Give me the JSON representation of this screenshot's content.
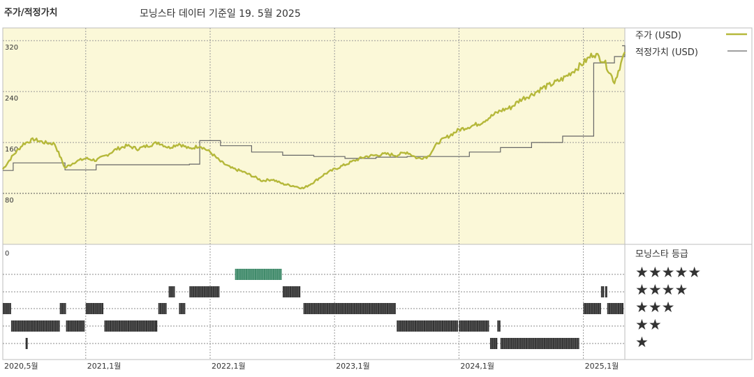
{
  "header": {
    "left_title": "주가/적정가치",
    "subtitle": "모닝스타 데이터 기준일 19. 5월 2025"
  },
  "colors": {
    "price_line": "#b5b83a",
    "fair_value_line": "#666666",
    "plot_bg": "#fbf8d8",
    "gold_rating": "#3f8a6a",
    "rating_bar": "#333333"
  },
  "chart_data": [
    {
      "type": "line",
      "x_unit": "month",
      "xlim": [
        "2020-05",
        "2025-05"
      ],
      "ylim": [
        0,
        340
      ],
      "y_ticks": [
        "0",
        "80",
        "160",
        "240",
        "320"
      ],
      "grid": true,
      "legend_position": "right",
      "series": [
        {
          "name": "주가 (USD)",
          "x": [
            "2020-05",
            "2020-06",
            "2020-07",
            "2020-08",
            "2020-09",
            "2020-10",
            "2020-11",
            "2020-12",
            "2021-01",
            "2021-02",
            "2021-03",
            "2021-04",
            "2021-05",
            "2021-06",
            "2021-07",
            "2021-08",
            "2021-09",
            "2021-10",
            "2021-11",
            "2021-12",
            "2022-01",
            "2022-02",
            "2022-03",
            "2022-04",
            "2022-05",
            "2022-06",
            "2022-07",
            "2022-08",
            "2022-09",
            "2022-10",
            "2022-11",
            "2022-12",
            "2023-01",
            "2023-02",
            "2023-03",
            "2023-04",
            "2023-05",
            "2023-06",
            "2023-07",
            "2023-08",
            "2023-09",
            "2023-10",
            "2023-11",
            "2023-12",
            "2024-01",
            "2024-02",
            "2024-03",
            "2024-04",
            "2024-05",
            "2024-06",
            "2024-07",
            "2024-08",
            "2024-09",
            "2024-10",
            "2024-11",
            "2024-12",
            "2025-01",
            "2025-02",
            "2025-03",
            "2025-04",
            "2025-05"
          ],
          "values": [
            118,
            140,
            158,
            165,
            160,
            158,
            120,
            130,
            135,
            132,
            140,
            150,
            155,
            150,
            155,
            160,
            152,
            158,
            150,
            155,
            145,
            130,
            120,
            115,
            108,
            100,
            102,
            95,
            92,
            88,
            98,
            110,
            118,
            125,
            132,
            138,
            140,
            142,
            140,
            145,
            135,
            138,
            160,
            170,
            180,
            185,
            190,
            200,
            210,
            215,
            228,
            235,
            245,
            252,
            260,
            272,
            285,
            300,
            288,
            255,
            302
          ]
        },
        {
          "name": "적정가치 (USD)",
          "x": [
            "2020-05",
            "2020-06",
            "2020-08",
            "2020-10",
            "2020-11",
            "2021-02",
            "2021-05",
            "2021-08",
            "2021-11",
            "2021-12",
            "2022-02",
            "2022-05",
            "2022-08",
            "2022-11",
            "2023-02",
            "2023-05",
            "2023-08",
            "2023-11",
            "2024-02",
            "2024-05",
            "2024-08",
            "2024-11",
            "2025-01",
            "2025-02",
            "2025-03",
            "2025-04",
            "2025-05"
          ],
          "values": [
            116,
            128,
            128,
            128,
            117,
            125,
            125,
            125,
            126,
            163,
            155,
            145,
            140,
            138,
            135,
            137,
            138,
            138,
            145,
            152,
            160,
            170,
            170,
            285,
            285,
            295,
            312
          ]
        }
      ]
    },
    {
      "type": "scatter",
      "title": "모닝스타 등급",
      "x_unit": "month",
      "xlim": [
        "2020-05",
        "2025-05"
      ],
      "x_tick_labels": [
        "2020,5월",
        "2021,1월",
        "2022,1월",
        "2023,1월",
        "2024,1월",
        "2025,1월"
      ],
      "levels": [
        5,
        4,
        3,
        2,
        1
      ],
      "level_labels": [
        "★★★★★",
        "★★★★",
        "★★★",
        "★★",
        "★"
      ],
      "segments": [
        {
          "stars": 3,
          "from": "2020-05",
          "to": "2020-05.8"
        },
        {
          "stars": 2,
          "from": "2020-05.8",
          "to": "2020-07.8"
        },
        {
          "stars": 1,
          "from": "2020-07.2",
          "to": "2020-07.4"
        },
        {
          "stars": 2,
          "from": "2020-07.8",
          "to": "2020-10.5"
        },
        {
          "stars": 3,
          "from": "2020-10.5",
          "to": "2020-11.1"
        },
        {
          "stars": 2,
          "from": "2020-11.1",
          "to": "2020-12.9"
        },
        {
          "stars": 3,
          "from": "2021-01",
          "to": "2021-02.7"
        },
        {
          "stars": 2,
          "from": "2021-02.8",
          "to": "2021-07.9"
        },
        {
          "stars": 3,
          "from": "2021-08",
          "to": "2021-08.8"
        },
        {
          "stars": 4,
          "from": "2021-09",
          "to": "2021-09.6"
        },
        {
          "stars": 3,
          "from": "2021-10",
          "to": "2021-10.6"
        },
        {
          "stars": 4,
          "from": "2021-11",
          "to": "2022-01.9"
        },
        {
          "stars": 5,
          "from": "2022-03.4",
          "to": "2022-07.9"
        },
        {
          "stars": 4,
          "from": "2022-08",
          "to": "2022-09.7"
        },
        {
          "stars": 3,
          "from": "2022-10",
          "to": "2023-06.9"
        },
        {
          "stars": 2,
          "from": "2023-07",
          "to": "2023-12.9"
        },
        {
          "stars": 2,
          "from": "2024-01",
          "to": "2024-03.9"
        },
        {
          "stars": 1,
          "from": "2024-04",
          "to": "2024-04.7"
        },
        {
          "stars": 2,
          "from": "2024-04.7",
          "to": "2024-05"
        },
        {
          "stars": 1,
          "from": "2024-05",
          "to": "2024-12.6"
        },
        {
          "stars": 3,
          "from": "2025-01",
          "to": "2025-02.7"
        },
        {
          "stars": 4,
          "from": "2025-02.7",
          "to": "2025-03.0"
        },
        {
          "stars": 4,
          "from": "2025-03.1",
          "to": "2025-03.3"
        },
        {
          "stars": 3,
          "from": "2025-03.3",
          "to": "2025-05"
        }
      ]
    }
  ]
}
